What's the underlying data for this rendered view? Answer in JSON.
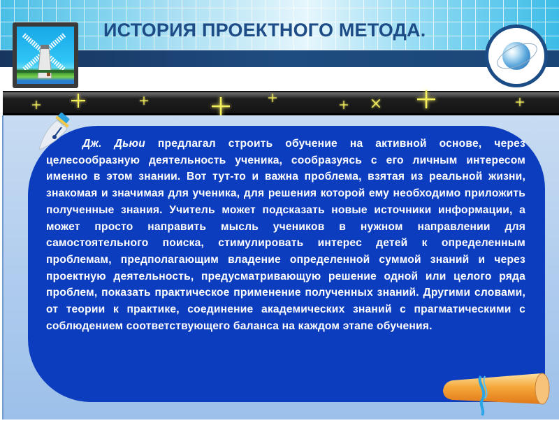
{
  "slide": {
    "title": "ИСТОРИЯ ПРОЕКТНОГО МЕТОДА.",
    "body": {
      "author": "Дж. Дьюи",
      "text": " предлагал строить обучение на активной основе, через целесообразную деятельность ученика, сообразуясь с его личным интересом именно в этом знании. Вот тут-то и важна проблема, взятая из реальной жизни, знакомая и значимая для ученика, для решения которой ему необходимо приложить полученные знания. Учитель может подсказать новые источники информации, а может просто направить мысль учеников в нужном направлении для самостоятельного поиска, стимулировать интерес детей к определенным проблемам, предполагающим владение определенной суммой знаний и через проектную деятельность, предусматривающую решение одной или целого ряда проблем, показать практическое применение полученных знаний. Другими словами, от теории к практике, соединение академических знаний с прагматическими с соблюдением соответствующего баланса на каждом этапе обучения."
    },
    "icons": {
      "logo": "windmill-icon",
      "globe": "globe-icon",
      "pen": "fountain-pen-icon",
      "scroll": "scroll-icon"
    },
    "colors": {
      "title": "#1d4b85",
      "band": "#1f4c80",
      "panel": "#0c3dbf",
      "background": "#b1cdee",
      "star": "#f4f05a"
    }
  }
}
